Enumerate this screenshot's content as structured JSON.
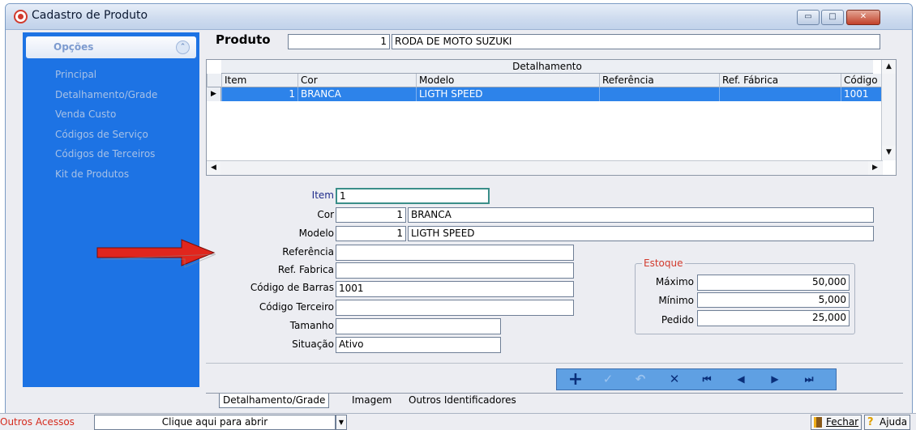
{
  "window": {
    "title": "Cadastro de Produto",
    "minimize": "▭",
    "maximize": "□",
    "close": "✕"
  },
  "sidebar": {
    "header": "Opções",
    "collapse_icon": "⌃",
    "items": [
      {
        "label": "Principal"
      },
      {
        "label": "Detalhamento/Grade"
      },
      {
        "label": "Venda Custo"
      },
      {
        "label": "Códigos de Serviço"
      },
      {
        "label": "Códigos de Terceiros"
      },
      {
        "label": "Kit de Produtos"
      }
    ]
  },
  "produto": {
    "label": "Produto",
    "code": "1",
    "name": "RODA DE MOTO SUZUKI"
  },
  "grid": {
    "title": "Detalhamento",
    "columns": [
      "Item",
      "Cor",
      "Modelo",
      "Referência",
      "Ref. Fábrica",
      "Código c"
    ],
    "rows": [
      {
        "item": "1",
        "cor": "BRANCA",
        "modelo": "LIGTH SPEED",
        "referencia": "",
        "ref_fabrica": "",
        "codigo": "1001"
      }
    ],
    "row_marker": "▶",
    "scroll_up": "▲",
    "scroll_down": "▼",
    "scroll_left": "◀",
    "scroll_right": "▶"
  },
  "form": {
    "item": {
      "label": "Item",
      "value": "1"
    },
    "cor": {
      "label": "Cor",
      "code": "1",
      "value": "BRANCA"
    },
    "modelo": {
      "label": "Modelo",
      "code": "1",
      "value": "LIGTH SPEED"
    },
    "referencia": {
      "label": "Referência",
      "value": ""
    },
    "ref_fabrica": {
      "label": "Ref. Fabrica",
      "value": ""
    },
    "codigo_barras": {
      "label": "Código de Barras",
      "value": "1001"
    },
    "codigo_terceiro": {
      "label": "Código Terceiro",
      "value": ""
    },
    "tamanho": {
      "label": "Tamanho",
      "value": ""
    },
    "situacao": {
      "label": "Situação",
      "value": "Ativo"
    }
  },
  "estoque": {
    "legend": "Estoque",
    "maximo": {
      "label": "Máximo",
      "value": "50,000"
    },
    "minimo": {
      "label": "Mínimo",
      "value": "5,000"
    },
    "pedido": {
      "label": "Pedido",
      "value": "25,000"
    }
  },
  "navigator": {
    "buttons": [
      {
        "name": "insert",
        "glyph": "+"
      },
      {
        "name": "post",
        "glyph": "✓"
      },
      {
        "name": "cancel",
        "glyph": "↶"
      },
      {
        "name": "delete",
        "glyph": "✕"
      },
      {
        "name": "first",
        "glyph": "⏮"
      },
      {
        "name": "prior",
        "glyph": "◀"
      },
      {
        "name": "next",
        "glyph": "▶"
      },
      {
        "name": "last",
        "glyph": "⏭"
      }
    ]
  },
  "tabs": [
    "Detalhamento/Grade",
    "Imagem",
    "Outros Identificadores"
  ],
  "statusbar": {
    "outros_acessos": "Outros Acessos",
    "clique": "Clique aqui para abrir",
    "dropdown": "▼",
    "fechar": "Fechar",
    "ajuda": "Ajuda"
  },
  "colors": {
    "sidebar": "#1d73e4",
    "selection": "#2d83ea",
    "accent_red": "#d23a2d"
  }
}
